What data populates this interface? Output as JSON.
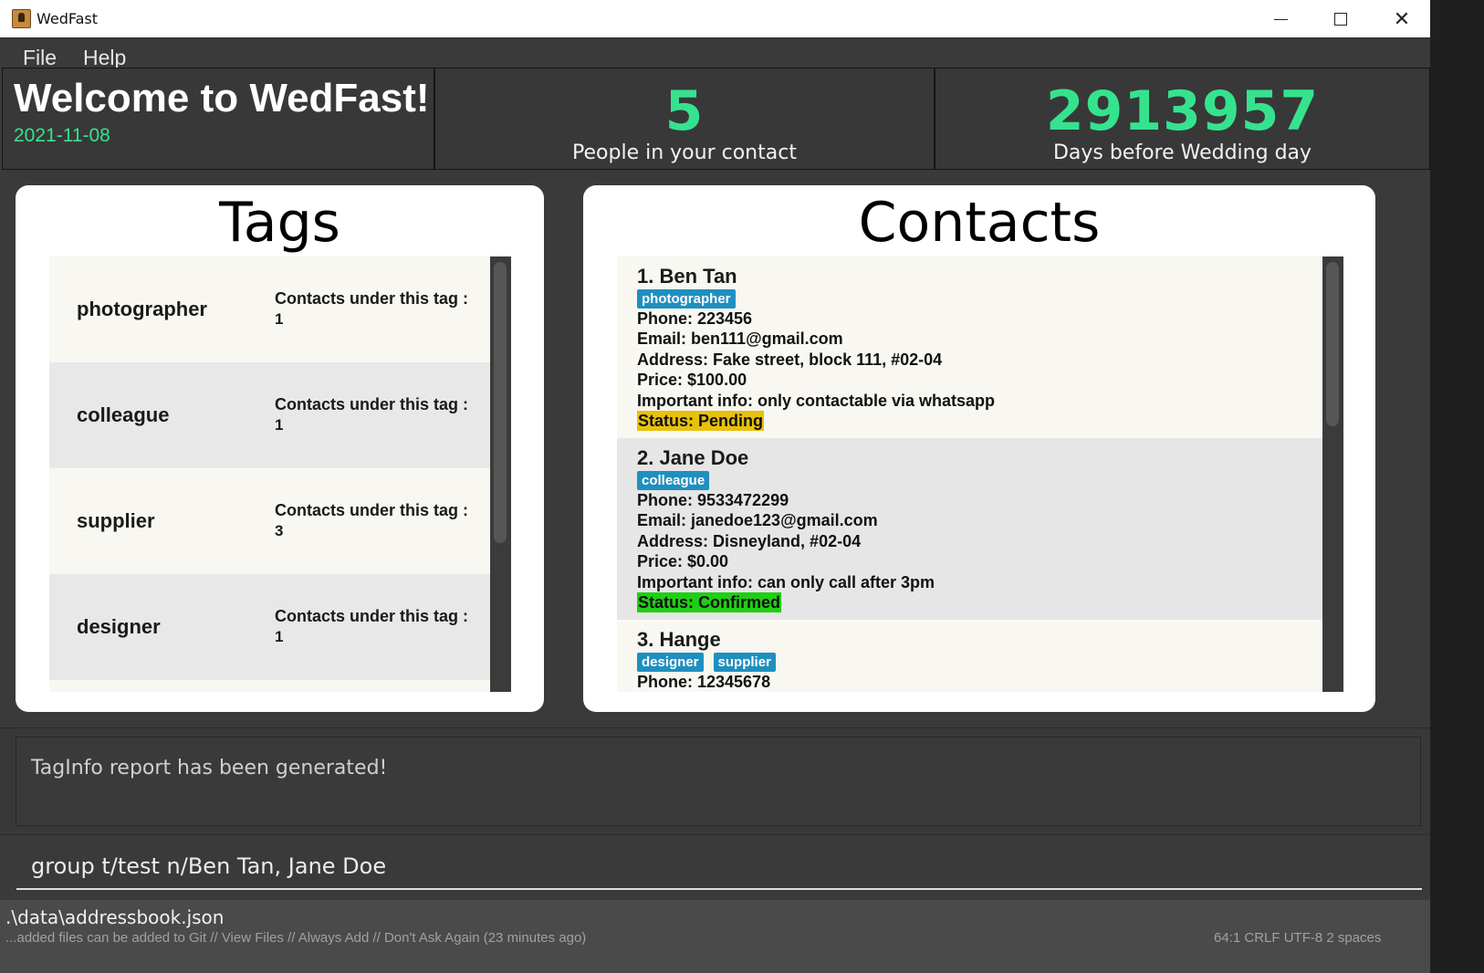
{
  "window": {
    "title": "WedFast"
  },
  "menu": {
    "file": "File",
    "help": "Help"
  },
  "header": {
    "welcome": "Welcome to WedFast!",
    "date": "2021-11-08",
    "people_count": "5",
    "people_label": "People in your contact",
    "days_count": "2913957",
    "days_label": "Days before Wedding day"
  },
  "tags_panel": {
    "title": "Tags",
    "count_label": "Contacts under this tag :",
    "items": [
      {
        "name": "photographer",
        "count": "1"
      },
      {
        "name": "colleague",
        "count": "1"
      },
      {
        "name": "supplier",
        "count": "3"
      },
      {
        "name": "designer",
        "count": "1"
      }
    ]
  },
  "contacts_panel": {
    "title": "Contacts",
    "contacts": [
      {
        "name": "1.  Ben Tan",
        "tags": [
          "photographer"
        ],
        "phone": "Phone: 223456",
        "email": "Email: ben111@gmail.com",
        "address": "Address: Fake street, block 111, #02-04",
        "price": "Price: $100.00",
        "info": "Important info: only contactable via whatsapp",
        "status": "Status: Pending"
      },
      {
        "name": "2.  Jane Doe",
        "tags": [
          "colleague"
        ],
        "phone": "Phone: 9533472299",
        "email": "Email: janedoe123@gmail.com",
        "address": "Address: Disneyland, #02-04",
        "price": "Price: $0.00",
        "info": "Important info: can only call after 3pm",
        "status": "Status: Confirmed"
      },
      {
        "name": "3.  Hange",
        "tags": [
          "designer",
          "supplier"
        ],
        "phone": "Phone: 12345678"
      }
    ]
  },
  "result": {
    "text": "TagInfo report has been generated!"
  },
  "command": {
    "value": "group t/test n/Ben Tan, Jane Doe"
  },
  "statusbar": {
    "path": ".\\data\\addressbook.json",
    "ghost_left": "...added files can be added to Git // View Files // Always Add // Don't Ask Again (23 minutes ago)",
    "ghost_right": "64:1   CRLF   UTF-8   2 spaces"
  },
  "colors": {
    "accent_green": "#35e38e",
    "tag_chip": "#1f8fc0",
    "status_pending": "#e8c10c",
    "status_confirmed": "#1fcf14"
  }
}
